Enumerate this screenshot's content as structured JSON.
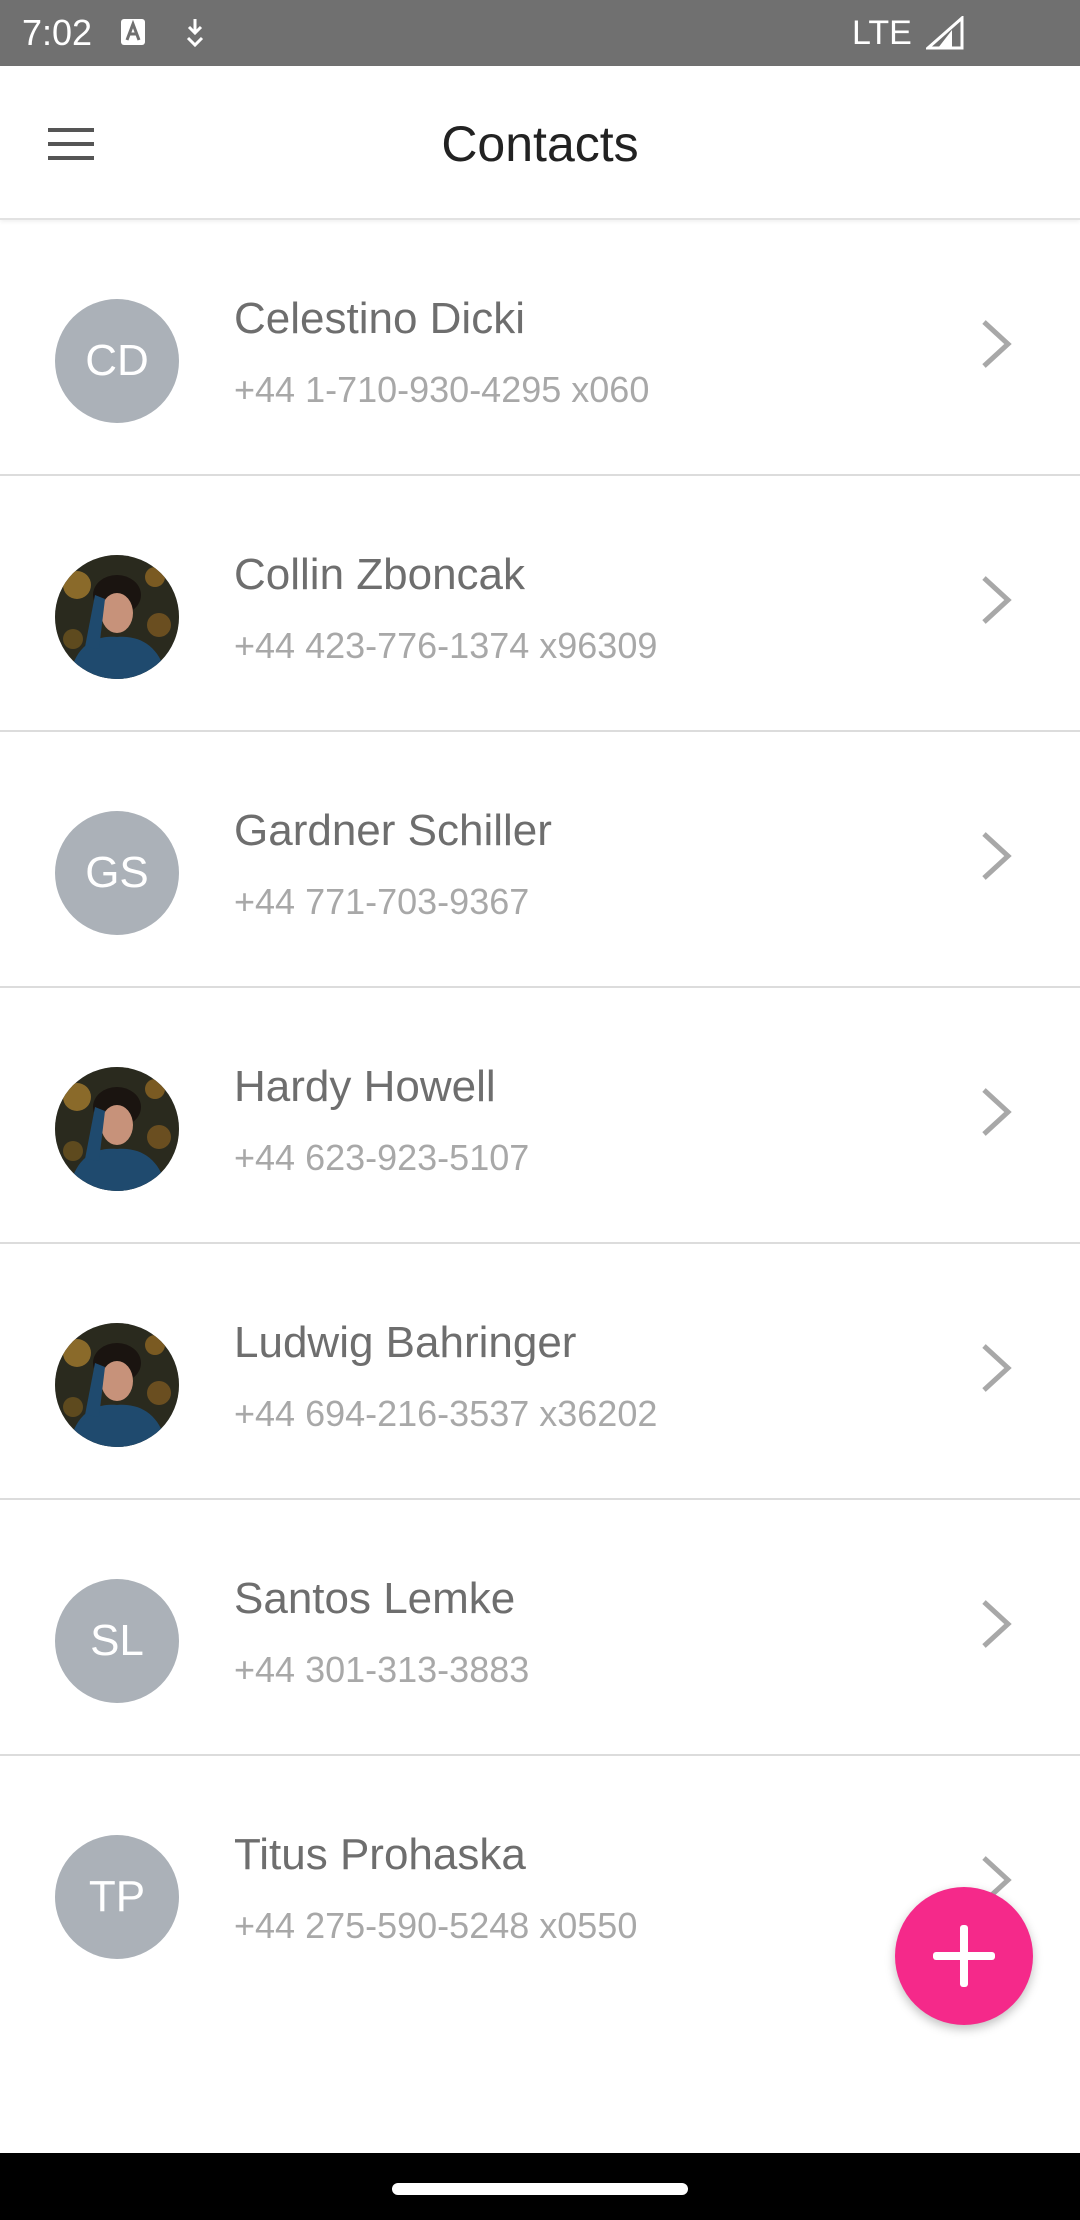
{
  "status_bar": {
    "time": "7:02",
    "network": "LTE",
    "icons": [
      "a-notification-icon",
      "download-icon",
      "signal-icon"
    ]
  },
  "app_bar": {
    "title": "Contacts",
    "menu_icon": "hamburger-menu-icon"
  },
  "contacts": [
    {
      "name": "Celestino Dicki",
      "phone": "+44 1-710-930-4295 x060",
      "initials": "CD",
      "avatar": "initials"
    },
    {
      "name": "Collin Zboncak",
      "phone": "+44 423-776-1374 x96309",
      "initials": "",
      "avatar": "photo"
    },
    {
      "name": "Gardner Schiller",
      "phone": "+44 771-703-9367",
      "initials": "GS",
      "avatar": "initials"
    },
    {
      "name": "Hardy Howell",
      "phone": "+44 623-923-5107",
      "initials": "",
      "avatar": "photo"
    },
    {
      "name": "Ludwig Bahringer",
      "phone": "+44 694-216-3537 x36202",
      "initials": "",
      "avatar": "photo"
    },
    {
      "name": "Santos Lemke",
      "phone": "+44 301-313-3883",
      "initials": "SL",
      "avatar": "initials"
    },
    {
      "name": "Titus Prohaska",
      "phone": "+44 275-590-5248 x0550",
      "initials": "TP",
      "avatar": "initials"
    }
  ],
  "fab": {
    "icon": "plus-icon"
  },
  "colors": {
    "status_bar": "#707070",
    "avatar_placeholder": "#abb1b8",
    "fab": "#f5298a",
    "name_text": "#6e6e6e",
    "phone_text": "#a8a8a8"
  }
}
